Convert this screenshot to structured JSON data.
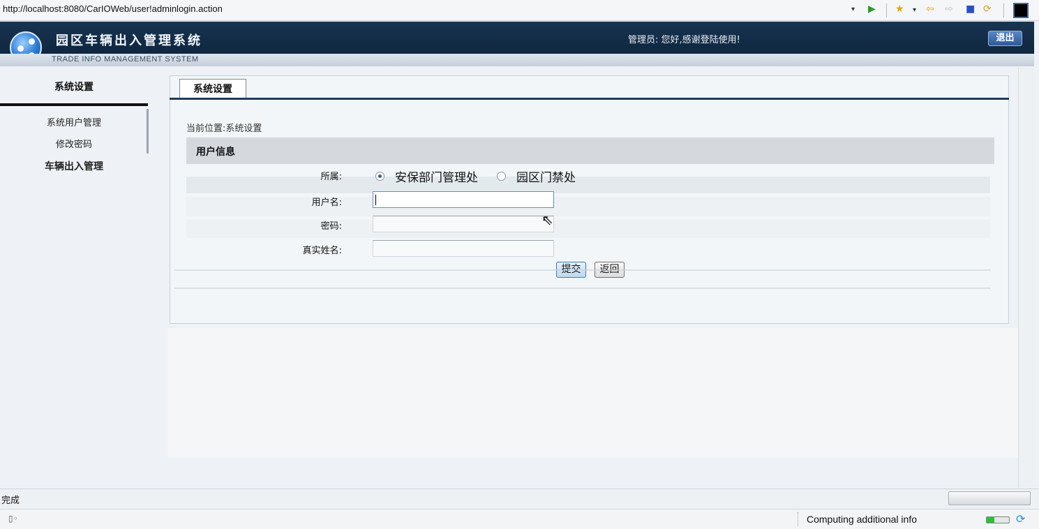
{
  "browser": {
    "url": "http://localhost:8080/CarIOWeb/user!adminlogin.action",
    "icons": {
      "dropdown": "▾",
      "go": "▶",
      "favorites": "★",
      "back": "⇦",
      "forward": "⇨",
      "stop": "■",
      "refresh": "⟳"
    }
  },
  "header": {
    "title": "园区车辆出入管理系统",
    "subtitle": "TRADE INFO MANAGEMENT SYSTEM",
    "welcome": "管理员:  您好,感谢登陆使用!",
    "logout_label": "退出"
  },
  "sidebar": {
    "title": "系统设置",
    "items": [
      {
        "label": "系统用户管理"
      },
      {
        "label": "修改密码"
      },
      {
        "label": "车辆出入管理"
      }
    ]
  },
  "main": {
    "tab_label": "系统设置",
    "breadcrumb": "当前位置:系统设置",
    "section_title": "用户信息",
    "form": {
      "affiliation_label": "所属:",
      "affiliation_options": [
        {
          "label": "安保部门管理处",
          "selected": true
        },
        {
          "label": "园区门禁处",
          "selected": false
        }
      ],
      "username_label": "用户名:",
      "username_value": "",
      "password_label": "密码:",
      "password_value": "",
      "realname_label": "真实姓名:",
      "realname_value": "",
      "submit_label": "提交",
      "back_label": "返回"
    }
  },
  "statusbar": {
    "status_text": "完成",
    "info_text": "Computing additional info"
  },
  "colors": {
    "header_bg": "#0f2740",
    "tab_rule": "#1f3b57",
    "section_bg": "#d5d9de",
    "logout_bg": "#2d5a99"
  }
}
